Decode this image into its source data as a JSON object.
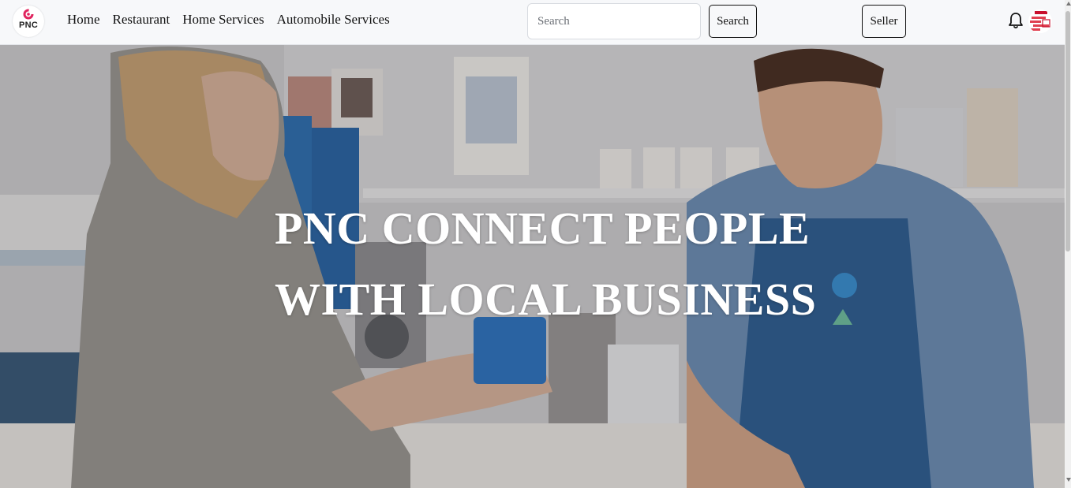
{
  "nav": {
    "logo_text": "PNC",
    "links": [
      "Home",
      "Restaurant",
      "Home Services",
      "Automobile Services"
    ],
    "search_placeholder": "Search",
    "search_button": "Search",
    "seller_button": "Seller",
    "icons": [
      "bell-icon",
      "user-avatar"
    ]
  },
  "hero": {
    "title_line1": "PNC CONNECT PEOPLE",
    "title_line2": "WITH LOCAL BUSINESS"
  },
  "colors": {
    "navbar_bg": "#f7f8fa",
    "logo_accent": "#e0245e",
    "hero_text": "#ffffff",
    "apron_blue": "#2f5f92"
  }
}
